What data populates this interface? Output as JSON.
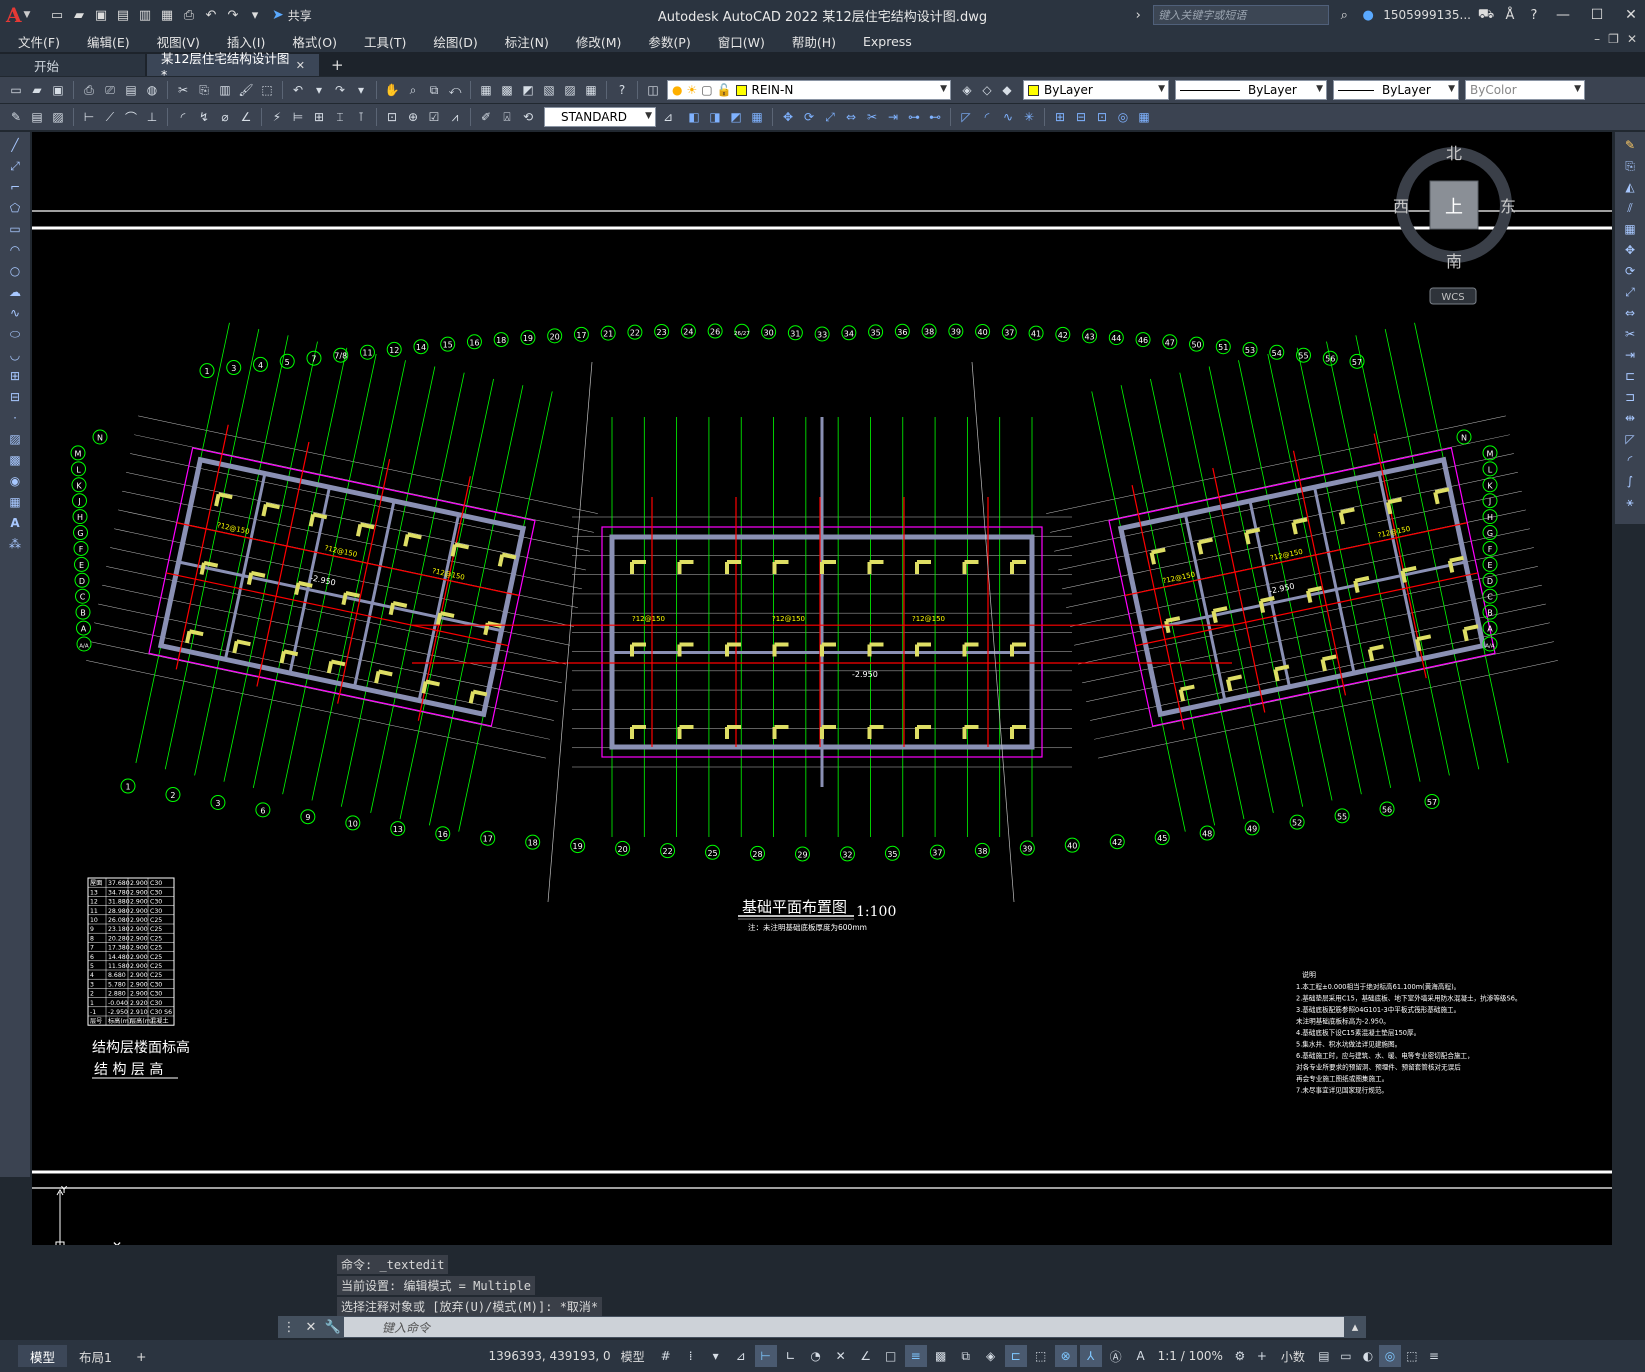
{
  "app": {
    "title": "Autodesk AutoCAD 2022    某12层住宅结构设计图.dwg",
    "share_label": "共享",
    "search_placeholder": "键入关键字或短语",
    "user": "1505999135...",
    "logo": "A"
  },
  "menu": [
    "文件(F)",
    "编辑(E)",
    "视图(V)",
    "插入(I)",
    "格式(O)",
    "工具(T)",
    "绘图(D)",
    "标注(N)",
    "修改(M)",
    "参数(P)",
    "窗口(W)",
    "帮助(H)",
    "Express"
  ],
  "tabs": {
    "start": "开始",
    "active": "某12层住宅结构设计图*"
  },
  "toolbar": {
    "layer": "REIN-N",
    "color": "ByLayer",
    "linetype": "ByLayer",
    "lineweight": "ByLayer",
    "plotstyle": "ByColor",
    "textstyle": "STANDARD"
  },
  "viewcube": {
    "north": "北",
    "south": "南",
    "east": "东",
    "west": "西",
    "top": "上",
    "wcs": "WCS"
  },
  "drawing": {
    "plan_title": "基础平面布置图",
    "plan_scale": "1:100",
    "plan_note": "注：未注明基础底板厚度为600mm",
    "table_title_1": "结构层楼面标高",
    "table_title_2": "结 构 层 高",
    "elev_label": "-2.950",
    "rebar_label": "?12@150",
    "floor_table": [
      [
        "屋面",
        "37.680",
        "2.900",
        "C30"
      ],
      [
        "13",
        "34.780",
        "2.900",
        "C30"
      ],
      [
        "12",
        "31.880",
        "2.900",
        "C30"
      ],
      [
        "11",
        "28.980",
        "2.900",
        "C30"
      ],
      [
        "10",
        "26.080",
        "2.900",
        "C25"
      ],
      [
        "9",
        "23.180",
        "2.900",
        "C25"
      ],
      [
        "8",
        "20.280",
        "2.900",
        "C25"
      ],
      [
        "7",
        "17.380",
        "2.900",
        "C25"
      ],
      [
        "6",
        "14.480",
        "2.900",
        "C25"
      ],
      [
        "5",
        "11.580",
        "2.900",
        "C25"
      ],
      [
        "4",
        "8.680",
        "2.900",
        "C25"
      ],
      [
        "3",
        "5.780",
        "2.900",
        "C30"
      ],
      [
        "2",
        "2.880",
        "2.900",
        "C30"
      ],
      [
        "1",
        "-0.040",
        "2.920",
        "C30"
      ],
      [
        "-1",
        "-2.950",
        "2.910",
        "C30 S6"
      ],
      [
        "层号",
        "标高(m)",
        "层高(m)",
        "混凝土"
      ]
    ],
    "notes_title": "说明",
    "notes": [
      "1.本工程±0.000相当于绝对标高61.100m(黄海高程)。",
      "2.基础垫层采用C15，基础底板、地下室外墙采用防水混凝土，抗渗等级S6。",
      "3.基础底板配筋参照04G101-3中平板式筏形基础施工。",
      "   未注明基础底板标高为-2.950。",
      "4.基础底板下设C15素混凝土垫层150厚。",
      "5.集水井、积水坑做法详见建施图。",
      "6.基础施工时，应与建筑、水、暖、电等专业密切配合施工，",
      "   对各专业所要求的预留洞、预埋件、预留套管核对无误后",
      "   再会专业施工图纸或图集施工。",
      "7.未尽事宜详见国家现行规范。"
    ],
    "axis_top": [
      "1",
      "3",
      "4",
      "5",
      "7",
      "7/8",
      "11",
      "12",
      "14",
      "15",
      "16",
      "18",
      "19",
      "20",
      "17",
      "21",
      "22",
      "23",
      "24",
      "26",
      "26/27",
      "30",
      "31",
      "33",
      "34",
      "35",
      "36",
      "38",
      "39",
      "40",
      "37",
      "41",
      "42",
      "43",
      "44",
      "46",
      "47",
      "50",
      "51",
      "53",
      "54",
      "55",
      "56",
      "57"
    ],
    "axis_bottom": [
      "1",
      "2",
      "3",
      "6",
      "9",
      "10",
      "13",
      "16",
      "17",
      "18",
      "19",
      "20",
      "22",
      "25",
      "28",
      "29",
      "32",
      "35",
      "37",
      "38",
      "39",
      "40",
      "42",
      "45",
      "48",
      "49",
      "52",
      "55",
      "56",
      "57"
    ],
    "axis_rows": [
      "N",
      "M",
      "L",
      "K",
      "J",
      "H",
      "G",
      "F",
      "E",
      "D",
      "C",
      "B",
      "A",
      "A/A"
    ]
  },
  "command": {
    "history": [
      "命令: _textedit",
      "当前设置: 编辑模式 = Multiple",
      "选择注释对象或 [放弃(U)/模式(M)]: *取消*"
    ],
    "placeholder": "键入命令"
  },
  "status": {
    "model_tab": "模型",
    "layout_tab": "布局1",
    "coords": "1396393, 439193, 0",
    "model_label": "模型",
    "scale": "1:1 / 100%",
    "units": "小数"
  },
  "colors": {
    "canvas": "#000000",
    "axis_green": "#00ff00",
    "wall_gray": "#8a90b4",
    "column_yellow": "#dede64",
    "rebar_red": "#ff0000",
    "boundary_magenta": "#ff00ff",
    "label_yellow": "#ffff00"
  }
}
